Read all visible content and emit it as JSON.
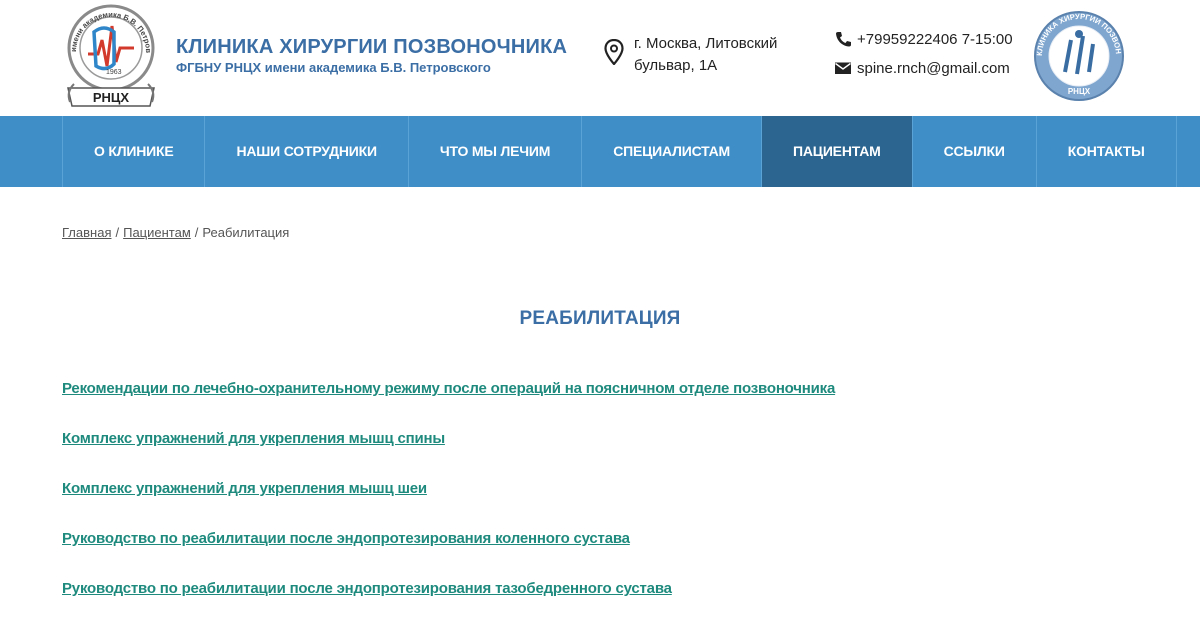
{
  "header": {
    "title": "КЛИНИКА ХИРУРГИИ ПОЗВОНОЧНИКА",
    "subtitle": "ФГБНУ РНЦХ имени академика Б.В. Петровского",
    "left_logo": {
      "arc_text": "имени академика Б.В. Петровского",
      "year": "1963",
      "ribbon": "РНЦХ"
    },
    "address": "г. Москва, Литовский бульвар, 1А",
    "phone": "+79959222406 7-15:00",
    "email": "spine.rnch@gmail.com",
    "right_logo": {
      "arc_text": "КЛИНИКА ХИРУРГИИ ПОЗВОНОЧНИКА",
      "bottom_text": "РНЦХ"
    }
  },
  "nav": {
    "items": [
      {
        "label": "О КЛИНИКЕ"
      },
      {
        "label": "НАШИ СОТРУДНИКИ"
      },
      {
        "label": "ЧТО МЫ ЛЕЧИМ"
      },
      {
        "label": "СПЕЦИАЛИСТАМ"
      },
      {
        "label": "ПАЦИЕНТАМ",
        "active": true
      },
      {
        "label": "ССЫЛКИ"
      },
      {
        "label": "КОНТАКТЫ"
      }
    ]
  },
  "breadcrumb": {
    "home": "Главная",
    "section": "Пациентам",
    "current": "Реабилитация",
    "separator": "/"
  },
  "page": {
    "title": "РЕАБИЛИТАЦИЯ",
    "links": [
      "Рекомендации по лечебно-охранительному режиму после операций на поясничном отделе позвоночника",
      "Комплекс упражнений для укрепления мышц спины",
      "Комплекс упражнений для укрепления мышц шеи",
      "Руководство по реабилитации после эндопротезирования коленного сустава",
      "Руководство по реабилитации после эндопротезирования тазобедренного сустава"
    ]
  },
  "colors": {
    "nav_bg": "#3f8ec7",
    "nav_active": "#2b6590",
    "brand_blue": "#3b6ea5",
    "link_teal": "#1e8a7e"
  }
}
